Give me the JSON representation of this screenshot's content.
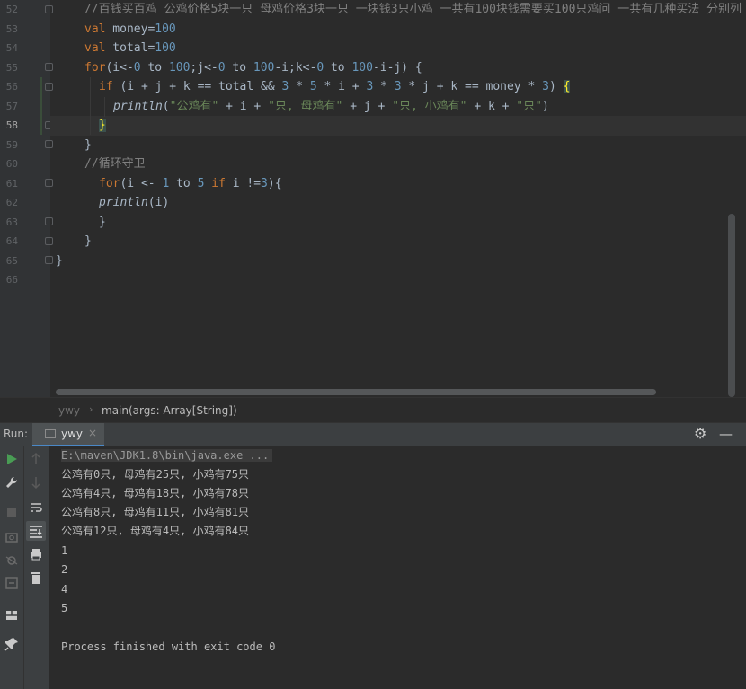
{
  "editor": {
    "line_numbers": [
      "52",
      "53",
      "54",
      "55",
      "56",
      "57",
      "58",
      "59",
      "60",
      "61",
      "62",
      "63",
      "64",
      "65",
      "66"
    ],
    "current_line": "58",
    "code": {
      "l52_comment": "//百钱买百鸡 公鸡价格5块一只 母鸡价格3块一只 一块钱3只小鸡 一共有100块钱需要买100只鸡问 一共有几种买法 分别列",
      "l53_kw": "val",
      "l53_name": " money=",
      "l53_num": "100",
      "l54_kw": "val",
      "l54_name": " total=",
      "l54_num": "100",
      "l55_kw": "for",
      "l55_a": "(i<-",
      "l55_n0": "0",
      "l55_to1": " to ",
      "l55_n100a": "100",
      "l55_b": ";j<-",
      "l55_n0b": "0",
      "l55_to2": " to ",
      "l55_n100b": "100",
      "l55_c": "-i;k<-",
      "l55_n0c": "0",
      "l55_to3": " to ",
      "l55_n100c": "100",
      "l55_d": "-i-j) {",
      "l56_kw": "if",
      "l56_a": " (i + j + k == total && ",
      "l56_n3": "3",
      "l56_b": " * ",
      "l56_n5": "5",
      "l56_c": " * i + ",
      "l56_n3b": "3",
      "l56_d": " * ",
      "l56_n3c": "3",
      "l56_e": " * j + k == money * ",
      "l56_n3d": "3",
      "l56_f": ") ",
      "l56_brace": "{",
      "l57_fn": "println",
      "l57_a": "(",
      "l57_s1": "\"公鸡有\"",
      "l57_b": " + i + ",
      "l57_s2": "\"只, 母鸡有\"",
      "l57_c": " + j + ",
      "l57_s3": "\"只, 小鸡有\"",
      "l57_d": " + k + ",
      "l57_s4": "\"只\"",
      "l57_e": ")",
      "l58_brace": "}",
      "l59": "}",
      "l60_comment": "//循环守卫",
      "l61_kw": "for",
      "l61_a": "(i <- ",
      "l61_n1": "1",
      "l61_to": " to ",
      "l61_n5": "5",
      "l61_sp": " ",
      "l61_if": "if",
      "l61_b": " i !=",
      "l61_n3": "3",
      "l61_c": "){",
      "l62_fn": "println",
      "l62_a": "(i)",
      "l63": "}",
      "l64": "}",
      "l65": "}"
    }
  },
  "breadcrumb": {
    "class_name": "ywy",
    "separator": "›",
    "method": "main(args: Array[String])"
  },
  "run_panel": {
    "label": "Run:",
    "tab_label": "ywy",
    "tab_close": "×",
    "settings_icon": "gear-icon",
    "minimize_icon": "minimize-icon",
    "console_lines": [
      "E:\\maven\\JDK1.8\\bin\\java.exe ...",
      "公鸡有0只, 母鸡有25只, 小鸡有75只",
      "公鸡有4只, 母鸡有18只, 小鸡有78只",
      "公鸡有8只, 母鸡有11只, 小鸡有81只",
      "公鸡有12只, 母鸡有4只, 小鸡有84只",
      "1",
      "2",
      "4",
      "5",
      "",
      "Process finished with exit code 0"
    ]
  },
  "colors": {
    "keyword": "#cc7832",
    "number": "#6897bb",
    "string": "#6a8759",
    "comment": "#808080",
    "default_text": "#a9b7c6",
    "run_green": "#499c54"
  }
}
